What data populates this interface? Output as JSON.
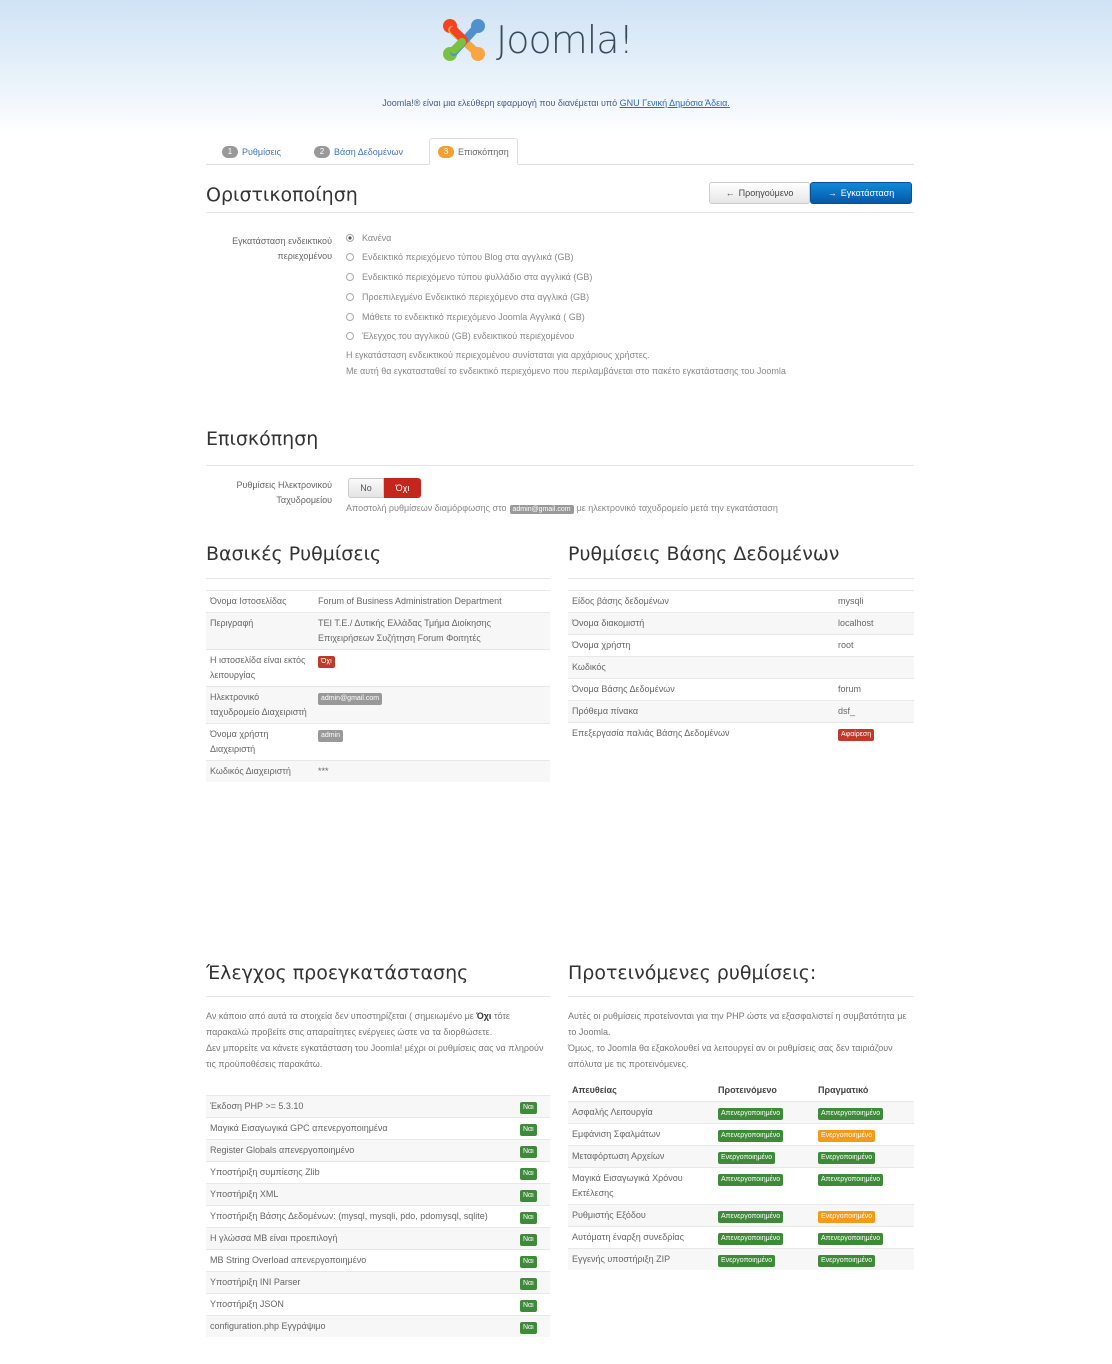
{
  "header": {
    "logo_text": "Joomla!",
    "tagline_before": "Joomla!® είναι μια ελεύθερη εφαρμογή που διανέμεται υπό ",
    "tagline_link": "GNU Γενική Δημόσια Άδεια."
  },
  "tabs": [
    {
      "num": "1",
      "label": "Ρυθμίσεις"
    },
    {
      "num": "2",
      "label": "Βάση Δεδομένων"
    },
    {
      "num": "3",
      "label": "Επισκόπηση"
    }
  ],
  "finalize": {
    "title": "Οριστικοποίηση",
    "prev_label": "Προηγούμενο",
    "install_label": "Εγκατάσταση",
    "sample_label": "Εγκατάσταση ενδεικτικού περιεχομένου",
    "options": [
      "Κανένα",
      "Ενδεικτικό περιεχόμενο τύπου Blog στα αγγλικά (GB)",
      "Ενδεικτικό περιεχόμενο τύπου φυλλάδιο στα αγγλικά (GB)",
      "Προεπιλεγμένο Ενδεικτικό περιεχόμενο στα αγγλικά (GB)",
      "Μάθετε το ενδεικτικό περιεχόμενο Joomla Αγγλικά ( GB)",
      "Έλεγχος του αγγλικού (GB) ενδεικτικού περιεχομένου"
    ],
    "note1": "Η εγκατάσταση ενδεικτικού περιεχομένου συνίσταται για αρχάριους χρήστες.",
    "note2": "Με αυτή θα εγκατασταθεί το ενδεικτικό περιεχόμενο που περιλαμβάνεται στο πακέτο εγκατάστασης του Joomla"
  },
  "overview": {
    "title": "Επισκόπηση",
    "email_settings_label": "Ρυθμίσεις Ηλεκτρονικού Ταχυδρομείου",
    "no_label": "Νο",
    "yes_label": "Όχι",
    "send_before": "Αποστολή ρυθμίσεων διαμόρφωσης στο",
    "send_email": "admin@gmail.com",
    "send_after": "με ηλεκτρονικό ταχυδρομείο μετά την εγκατάσταση"
  },
  "basic": {
    "title": "Βασικές Ρυθμίσεις",
    "rows": [
      {
        "key": "Όνομα Ιστοσελίδας",
        "value": "Forum of Business Administration Department"
      },
      {
        "key": "Περιγραφή",
        "value": "ΤΕΙ Τ.Ε./ Δυτικής Ελλάδας Τμήμα Διοίκησης Επιχειρήσεων Συζήτηση Forum Φοιτητές"
      },
      {
        "key": "Η ιστοσελίδα είναι εκτός λειτουργίας",
        "badge": "Όχι"
      },
      {
        "key": "Ηλεκτρονικό ταχυδρομείο Διαχειριστή",
        "badge": "admin@gmail.com"
      },
      {
        "key": "Όνομα χρήστη Διαχειριστή",
        "badge": "admin"
      },
      {
        "key": "Κωδικός Διαχειριστή",
        "value": "***"
      }
    ]
  },
  "database": {
    "title": "Ρυθμίσεις Βάσης Δεδομένων",
    "rows": [
      {
        "key": "Είδος βάσης δεδομένων",
        "value": "mysqli"
      },
      {
        "key": "Όνομα διακομιστή",
        "value": "localhost"
      },
      {
        "key": "Όνομα χρήστη",
        "value": "root"
      },
      {
        "key": "Κωδικός",
        "value": ""
      },
      {
        "key": "Όνομα Βάσης Δεδομένων",
        "value": "forum"
      },
      {
        "key": "Πρόθεμα πίνακα",
        "value": "dsf_"
      },
      {
        "key": "Επεξεργασία παλιάς Βάσης Δεδομένων",
        "badge": "Αφαίρεση"
      }
    ]
  },
  "precheck": {
    "title": "Έλεγχος προεγκατάστασης",
    "p1_before": "Αν κάποιο από αυτά τα στοιχεία δεν υποστηρίζεται ( σημειωμένο με ",
    "p1_bold": "Όχι",
    "p1_after": " τότε παρακαλώ προβείτε στις απαραίτητες ενέργειες ώστε να τα διορθώσετε.",
    "p2": "Δεν μπορείτε να κάνετε εγκατάσταση του Joomla! μέχρι οι ρυθμίσεις σας να πληρούν τις προϋποθέσεις παρακάτω.",
    "yes": "Ναι",
    "rows": [
      "Έκδοση PHP >= 5.3.10",
      "Μαγικά Εισαγωγικά GPC απενεργοποιημένα",
      "Register Globals απενεργοποιημένο",
      "Υποστήριξη συμπίεσης Zlib",
      "Υποστήριξη XML",
      "Υποστήριξη Βάσης Δεδομένων: (mysql, mysqli, pdo, pdomysql, sqlite)",
      "Η γλώσσα MB είναι προεπιλογή",
      "MB String Overload απενεργοποιημένο",
      "Υποστήριξη INI Parser",
      "Υποστήριξη JSON",
      "configuration.php Εγγράψιμο"
    ]
  },
  "recommended": {
    "title": "Προτεινόμενες ρυθμίσεις:",
    "p1": "Αυτές οι ρυθμίσεις προτείνονται για την PHP ώστε να εξασφαλιστεί η συμβατότητα με το Joomla.",
    "p2": "Όμως, το Joomla θα εξακολουθεί να λειτουργεί αν οι ρυθμίσεις σας δεν ταιριάζουν απόλυτα με τις προτεινόμενες.",
    "headers": [
      "Απευθείας",
      "Προτεινόμενο",
      "Πραγματικό"
    ],
    "rows": [
      {
        "name": "Ασφαλής Λειτουργία",
        "rec": "Απενεργοποιημένο",
        "act": "Απενεργοποιημένο",
        "act_color": "green"
      },
      {
        "name": "Εμφάνιση Σφαλμάτων",
        "rec": "Απενεργοποιημένο",
        "act": "Ενεργοποιημένο",
        "act_color": "orange"
      },
      {
        "name": "Μεταφόρτωση Αρχείων",
        "rec": "Ενεργοποιημένο",
        "act": "Ενεργοποιημένο",
        "act_color": "green"
      },
      {
        "name": "Μαγικά Εισαγωγικά Χρόνου Εκτέλεσης",
        "rec": "Απενεργοποιημένο",
        "act": "Απενεργοποιημένο",
        "act_color": "green"
      },
      {
        "name": "Ρυθμιστής Εξόδου",
        "rec": "Απενεργοποιημένο",
        "act": "Ενεργοποιημένο",
        "act_color": "orange"
      },
      {
        "name": "Αυτόματη έναρξη συνεδρίας",
        "rec": "Απενεργοποιημένο",
        "act": "Απενεργοποιημένο",
        "act_color": "green"
      },
      {
        "name": "Εγγενής υποστήριξη ZIP",
        "rec": "Ενεργοποιημένο",
        "act": "Ενεργοποιημένο",
        "act_color": "green"
      }
    ]
  },
  "colors": {
    "primary": "#0a6fc2",
    "danger": "#c4261d",
    "success": "#3f8a3a",
    "warning": "#f29a19"
  }
}
